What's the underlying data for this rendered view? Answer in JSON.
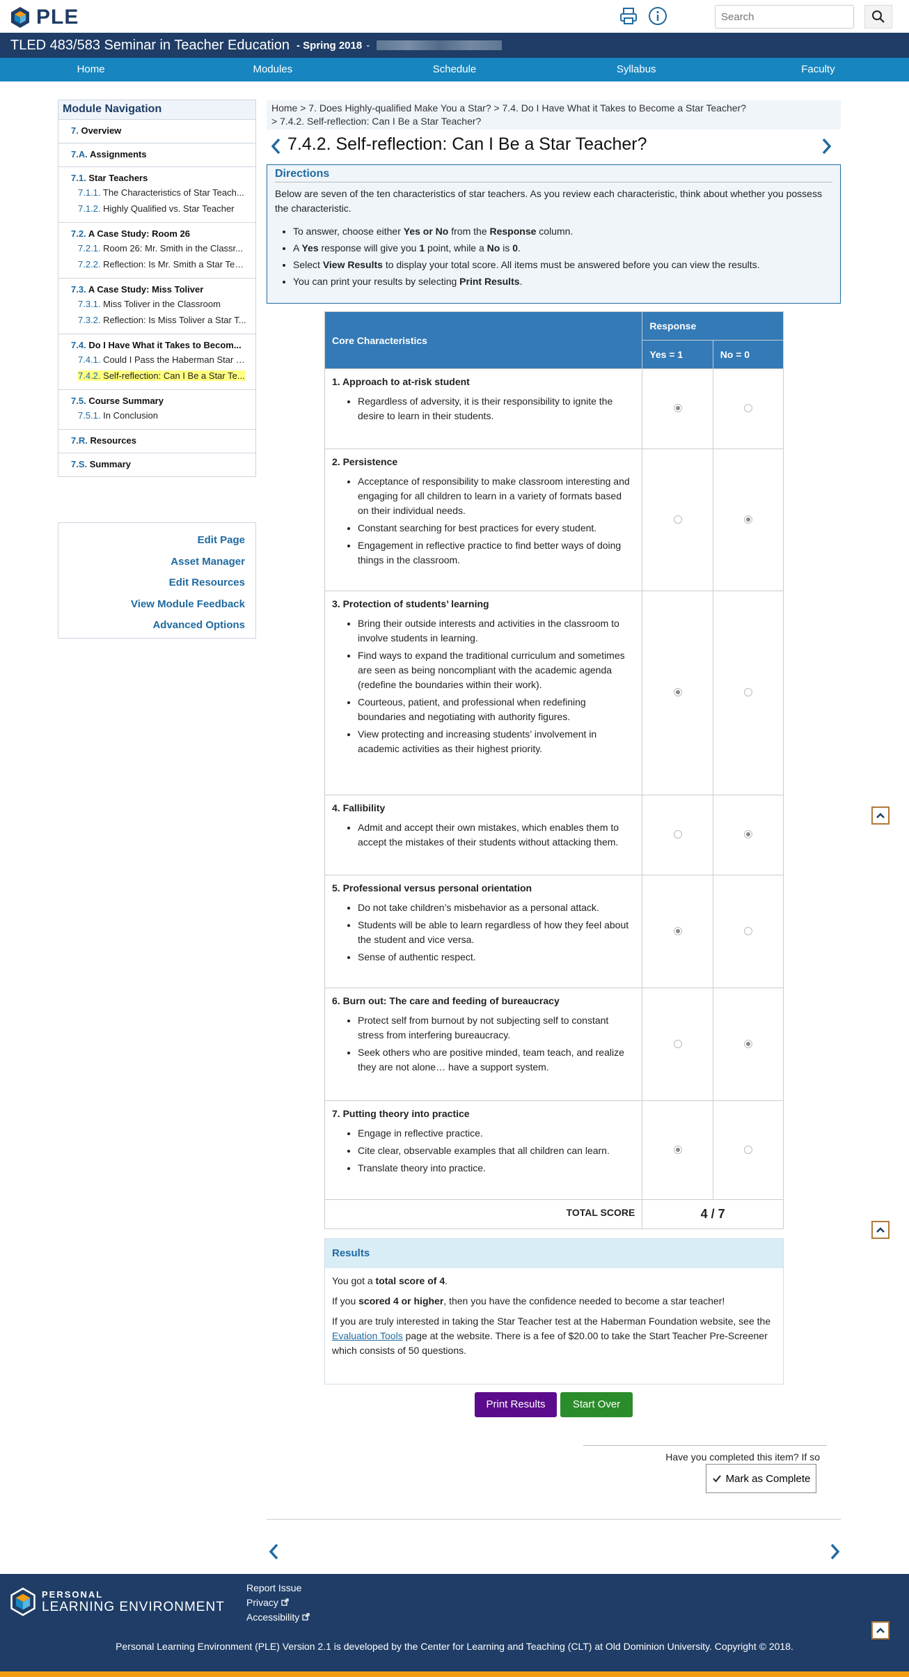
{
  "header": {
    "brand": "PLE",
    "search_placeholder": "Search",
    "icons": [
      "print-icon",
      "info-icon",
      "search-icon"
    ]
  },
  "course": {
    "title": "TLED 483/583 Seminar in Teacher Education",
    "term": "- Spring 2018",
    "term_suffix": "-"
  },
  "nav": {
    "items": [
      "Home",
      "Modules",
      "Schedule",
      "Syllabus",
      "Faculty"
    ]
  },
  "sidebar": {
    "heading": "Module Navigation",
    "groups": [
      {
        "num": "7.",
        "title": "Overview",
        "items": []
      },
      {
        "num": "7.A.",
        "title": "Assignments",
        "items": []
      },
      {
        "num": "7.1.",
        "title": "Star Teachers",
        "items": [
          {
            "num": "7.1.1.",
            "label": "The Characteristics of Star Teach..."
          },
          {
            "num": "7.1.2.",
            "label": "Highly Qualified vs. Star Teacher"
          }
        ]
      },
      {
        "num": "7.2.",
        "title": "A Case Study: Room 26",
        "items": [
          {
            "num": "7.2.1.",
            "label": "Room 26: Mr. Smith in the Classr..."
          },
          {
            "num": "7.2.2.",
            "label": "Reflection: Is Mr. Smith a Star Tea..."
          }
        ]
      },
      {
        "num": "7.3.",
        "title": "A Case Study: Miss Toliver",
        "items": [
          {
            "num": "7.3.1.",
            "label": "Miss Toliver in the Classroom"
          },
          {
            "num": "7.3.2.",
            "label": "Reflection: Is Miss Toliver a Star T..."
          }
        ]
      },
      {
        "num": "7.4.",
        "title": "Do I Have What it Takes to Becom...",
        "items": [
          {
            "num": "7.4.1.",
            "label": "Could I Pass the Haberman Star T..."
          },
          {
            "num": "7.4.2.",
            "label": "Self-reflection: Can I Be a Star Te..."
          }
        ]
      },
      {
        "num": "7.5.",
        "title": "Course Summary",
        "items": [
          {
            "num": "7.5.1.",
            "label": "In Conclusion"
          }
        ]
      },
      {
        "num": "7.R.",
        "title": "Resources",
        "items": []
      },
      {
        "num": "7.S.",
        "title": "Summary",
        "items": []
      }
    ],
    "tools": [
      "Edit Page",
      "Asset Manager",
      "Edit Resources",
      "View Module Feedback",
      "Advanced Options"
    ]
  },
  "breadcrumb": {
    "line1": "Home > 7. Does Highly-qualified Make You a Star? > 7.4. Do I Have What it Takes to Become a Star Teacher?",
    "line2": "> 7.4.2. Self-reflection: Can I Be a Star Teacher?"
  },
  "page": {
    "title": "7.4.2. Self-reflection: Can I Be a Star Teacher?"
  },
  "directions": {
    "heading": "Directions",
    "intro": "Below are seven of the ten characteristics of star teachers. As you review each characteristic, think about whether you possess the characteristic.",
    "bullets": [
      {
        "a": "To answer, choose either ",
        "b": "Yes or No",
        "c": " from the ",
        "d": "Response",
        "e": " column."
      },
      {
        "a": "A ",
        "b": "Yes",
        "c": " response will give you ",
        "d": "1",
        "e": " point, while a ",
        "f": "No",
        "g": " is ",
        "h": "0",
        "i": "."
      },
      {
        "a": "Select ",
        "b": "View Results",
        "c": " to display your total score. All items must be answered before you can view the results."
      },
      {
        "a": "You can print your results by selecting ",
        "b": "Print Results",
        "c": "."
      }
    ]
  },
  "table": {
    "col_characteristics": "Core Characteristics",
    "col_response": "Response",
    "col_yes": "Yes = 1",
    "col_no": "No = 0",
    "rows": [
      {
        "title": "1. Approach to at-risk student",
        "answer": "yes",
        "bullets": [
          "Regardless of adversity, it is their responsibility to ignite the desire to learn in their students."
        ]
      },
      {
        "title": "2. Persistence",
        "answer": "no",
        "bullets": [
          "Acceptance of responsibility to make classroom interesting and engaging for all children to learn in a variety of formats based on their individual needs.",
          "Constant searching for best practices for every student.",
          "Engagement in reflective practice to find better ways of doing things in the classroom."
        ]
      },
      {
        "title": "3. Protection of students’ learning",
        "answer": "yes",
        "bullets": [
          "Bring their outside interests and activities in the classroom to involve students in learning.",
          "Find ways to expand the traditional curriculum and sometimes are seen as being noncompliant with the academic agenda (redefine the boundaries within their work).",
          "Courteous, patient, and professional when redefining boundaries and negotiating with authority figures.",
          "View protecting and increasing students’ involvement in academic activities as their highest priority."
        ]
      },
      {
        "title": "4. Fallibility",
        "answer": "no",
        "bullets": [
          "Admit and accept their own mistakes, which enables them to accept the mistakes of their students without attacking them."
        ]
      },
      {
        "title": "5. Professional versus personal orientation",
        "answer": "yes",
        "bullets": [
          "Do not take children’s misbehavior as a personal attack.",
          "Students will be able to learn regardless of how they feel about the student and vice versa.",
          "Sense of authentic respect."
        ]
      },
      {
        "title": "6. Burn out: The care and feeding of bureaucracy",
        "answer": "no",
        "bullets": [
          "Protect self from burnout by not subjecting self to constant stress from interfering bureaucracy.",
          "Seek others who are positive minded, team teach, and realize they are not alone… have a support system."
        ]
      },
      {
        "title": "7. Putting theory into practice",
        "answer": "yes",
        "bullets": [
          "Engage in reflective practice.",
          "Cite clear, observable examples that all children can learn.",
          "Translate theory into practice."
        ]
      }
    ],
    "total_label": "TOTAL SCORE",
    "total_value": "4 / 7"
  },
  "results": {
    "heading": "Results",
    "p1a": "You got a ",
    "p1b": "total score of 4",
    "p1c": ".",
    "p2a": "If you ",
    "p2b": "scored 4 or higher",
    "p2c": ", then you have the confidence needed to become a star teacher!",
    "p3a": "If you are truly interested in taking the Star Teacher test at the Haberman Foundation website, see the ",
    "p3link": "Evaluation Tools",
    "p3b": " page at the website. There is a fee of $20.00 to take the Start Teacher Pre-Screener which consists of 50 questions."
  },
  "buttons": {
    "print": "Print Results",
    "start_over": "Start Over",
    "print_color": "#5b0c8c",
    "start_color": "#2a8c2a"
  },
  "complete": {
    "question": "Have you completed this item? If so",
    "button": "Mark as Complete"
  },
  "footer": {
    "logo_line1": "PERSONAL",
    "logo_line2": "LEARNING ENVIRONMENT",
    "links": [
      "Report Issue",
      "Privacy",
      "Accessibility"
    ],
    "copyright": "Personal Learning Environment (PLE) Version 2.1 is developed by the Center for Learning and Teaching (CLT) at Old Dominion University. Copyright © 2018."
  }
}
